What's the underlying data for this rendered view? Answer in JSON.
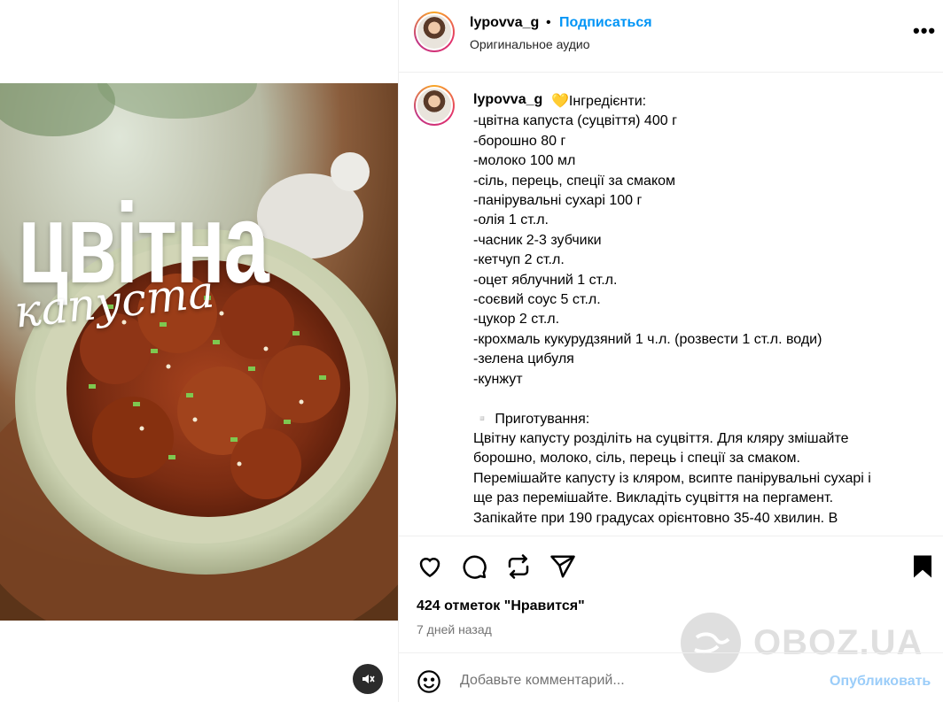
{
  "media": {
    "title": "цвітна",
    "subtitle": "капуста",
    "mute_icon": "speaker-muted-icon"
  },
  "header": {
    "username": "lypovva_g",
    "dot": "•",
    "follow_label": "Подписаться",
    "audio": "Оригинальное аудио",
    "more": "•••"
  },
  "caption": {
    "username": "lypovva_g",
    "lines": [
      "💛Інгредієнти:",
      "-цвітна капуста (суцвіття) 400 г",
      "-борошно 80 г",
      "-молоко 100 мл",
      "-сіль, перець, спеції за смаком",
      "-панірувальні сухарі 100 г",
      "-олія 1 ст.л.",
      "-часник 2-3 зубчики",
      "-кетчуп 2 ст.л.",
      "-оцет яблучний 1 ст.л.",
      "-соєвий соус 5 ст.л.",
      "-цукор 2 ст.л.",
      "-крохмаль кукурудзяний 1 ч.л. (розвести 1 ст.л. води)",
      "-зелена цибуля",
      "-кунжут",
      "",
      "▫️ Приготування:",
      "Цвітну капусту розділіть на суцвіття. Для кляру змішайте",
      "борошно, молоко, сіль, перець і спеції за смаком.",
      "Перемішайте капусту із кляром, всипте панірувальні сухарі і",
      "ще раз перемішайте. Викладіть суцвіття на пергамент.",
      "Запікайте при 190 градусах орієнтовно 35-40 хвилин. В"
    ]
  },
  "actions": {
    "like_icon": "heart-icon",
    "comment_icon": "comment-icon",
    "repost_icon": "repost-icon",
    "share_icon": "send-icon",
    "save_icon": "bookmark-icon"
  },
  "likes": "424 отметок \"Нравится\"",
  "date": "7 дней назад",
  "watermark": "OBOZ.UA",
  "comment": {
    "emoji_icon": "smiley-icon",
    "placeholder": "Добавьте комментарий...",
    "publish_label": "Опубликовать"
  }
}
